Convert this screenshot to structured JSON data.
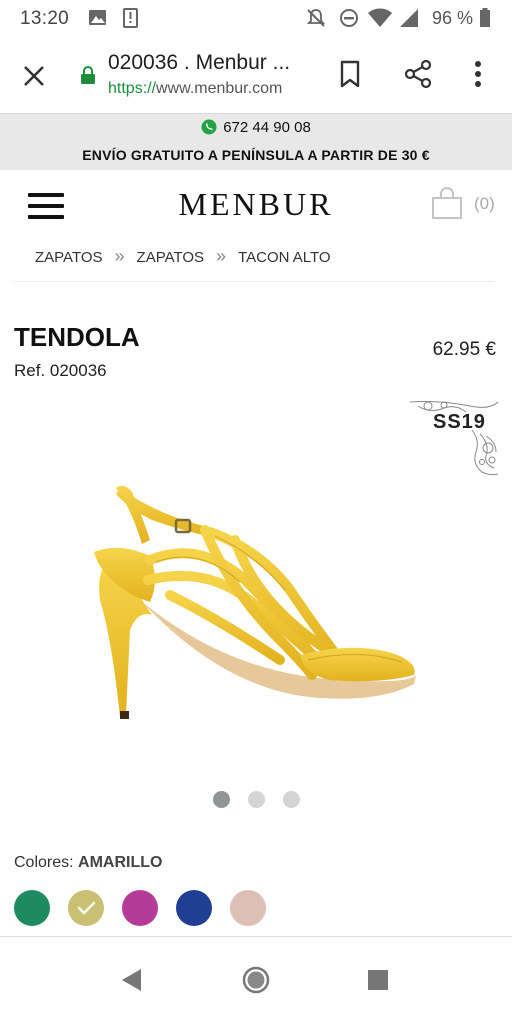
{
  "status_bar": {
    "time": "13:20",
    "battery": "96 %",
    "icons": [
      "image-icon",
      "download-icon",
      "mute-icon",
      "dnd-icon",
      "wifi-icon",
      "signal-icon",
      "battery-icon"
    ]
  },
  "browser": {
    "title": "020036 . Menbur ...",
    "url_scheme": "https://",
    "url_host": "www.menbur.com",
    "icons": [
      "close-icon",
      "lock-icon",
      "bookmark-icon",
      "share-icon",
      "more-icon"
    ]
  },
  "promo": {
    "phone": "672 44 90 08",
    "shipping": "ENVÍO GRATUITO A PENÍNSULA A PARTIR DE 30 €"
  },
  "header": {
    "logo": "MENBUR",
    "cart_count": "(0)"
  },
  "breadcrumb": [
    "ZAPATOS",
    "ZAPATOS",
    "TACON ALTO"
  ],
  "breadcrumb_separator": "»",
  "product": {
    "name": "TENDOLA",
    "ref": "Ref. 020036",
    "price": "62.95 €",
    "season": "SS19",
    "image_slide": 1,
    "image_slides_total": 3
  },
  "colors": {
    "label": "Colores:",
    "selected": "AMARILLO",
    "swatches": [
      {
        "color": "#1f8a5f",
        "selected": false
      },
      {
        "color": "#c9c074",
        "selected": true
      },
      {
        "color": "#b53b9b",
        "selected": false
      },
      {
        "color": "#203f94",
        "selected": false
      },
      {
        "color": "#dcbfb5",
        "selected": false
      }
    ]
  },
  "theme": {
    "accent_green": "#1e8e3e",
    "promo_bg": "#e8e8e8",
    "shoe_yellow": "#f2c934"
  },
  "nav": {
    "icons": [
      "back-icon",
      "home-icon",
      "recents-icon"
    ]
  }
}
